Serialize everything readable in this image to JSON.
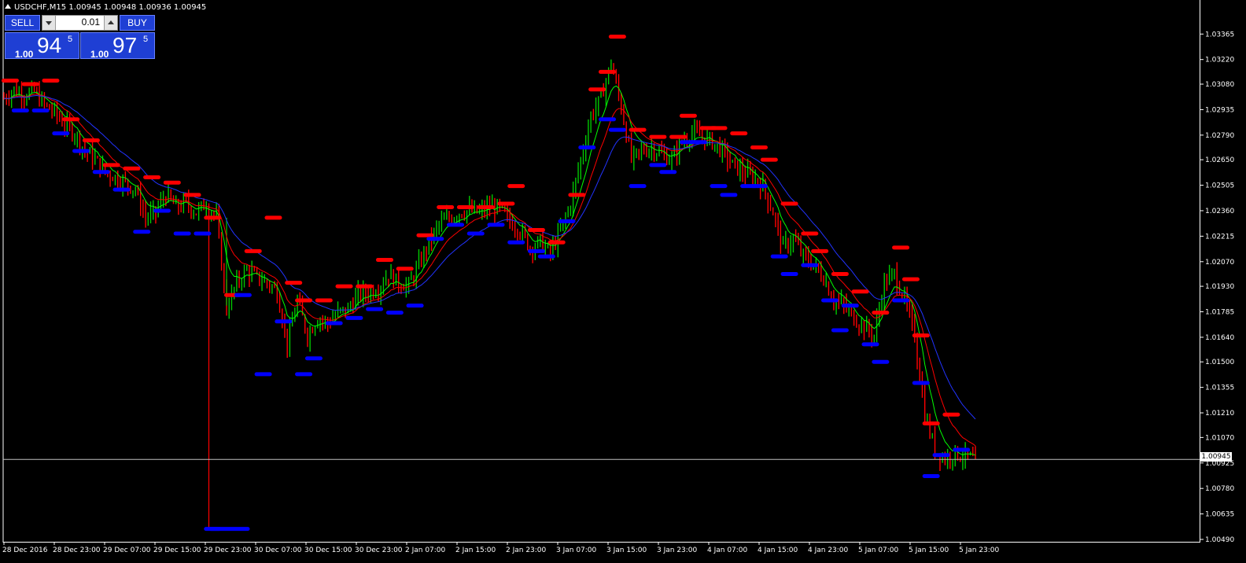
{
  "window": {
    "title": "USDCHF,M15  1.00945 1.00948 1.00936 1.00945"
  },
  "trade_panel": {
    "sell_label": "SELL",
    "buy_label": "BUY",
    "lot_value": "0.01",
    "sell_price": {
      "big": "1.00",
      "main": "94",
      "sup": "5"
    },
    "buy_price": {
      "big": "1.00",
      "main": "97",
      "sup": "5"
    }
  },
  "current_price_label": "1.00945",
  "colors": {
    "background": "#000000",
    "bull_candle": "#00c800",
    "bear_candle": "#ff0000",
    "axis": "#ffffff",
    "panel_blue": "#1f3fd4",
    "ma_fast": "#00ff00",
    "ma_mid": "#ff0000",
    "ma_slow": "#2233ff",
    "fractal_up": "#ff0000",
    "fractal_down": "#0000ff"
  },
  "chart_data": {
    "type": "candlestick",
    "symbol": "USDCHF",
    "timeframe": "M15",
    "ylim": [
      1.0049,
      1.0342
    ],
    "y_ticks": [
      "1.03365",
      "1.03220",
      "1.03080",
      "1.02935",
      "1.02790",
      "1.02650",
      "1.02505",
      "1.02360",
      "1.02215",
      "1.02070",
      "1.01930",
      "1.01785",
      "1.01640",
      "1.01500",
      "1.01355",
      "1.01210",
      "1.01070",
      "1.00925",
      "1.00780",
      "1.00635",
      "1.00490"
    ],
    "x_ticks": [
      "28 Dec 2016",
      "28 Dec 23:00",
      "29 Dec 07:00",
      "29 Dec 15:00",
      "29 Dec 23:00",
      "30 Dec 07:00",
      "30 Dec 15:00",
      "30 Dec 23:00",
      "2 Jan 07:00",
      "2 Jan 15:00",
      "2 Jan 23:00",
      "3 Jan 07:00",
      "3 Jan 15:00",
      "3 Jan 23:00",
      "4 Jan 07:00",
      "4 Jan 15:00",
      "4 Jan 23:00",
      "5 Jan 07:00",
      "5 Jan 15:00",
      "5 Jan 23:00"
    ],
    "current_price": 1.00945,
    "close_path": [
      [
        0,
        1.03
      ],
      [
        2,
        1.0305
      ],
      [
        4,
        1.0302
      ],
      [
        6,
        1.0304
      ],
      [
        8,
        1.0296
      ],
      [
        10,
        1.0292
      ],
      [
        12,
        1.0285
      ],
      [
        14,
        1.028
      ],
      [
        16,
        1.027
      ],
      [
        18,
        1.0265
      ],
      [
        20,
        1.0258
      ],
      [
        22,
        1.0255
      ],
      [
        24,
        1.0252
      ],
      [
        26,
        1.0248
      ],
      [
        28,
        1.0232
      ],
      [
        30,
        1.0235
      ],
      [
        32,
        1.0245
      ],
      [
        34,
        1.0238
      ],
      [
        36,
        1.024
      ],
      [
        38,
        1.0235
      ],
      [
        40,
        1.024
      ],
      [
        42,
        1.0232
      ],
      [
        44,
        1.018
      ],
      [
        46,
        1.0195
      ],
      [
        48,
        1.0202
      ],
      [
        50,
        1.0198
      ],
      [
        52,
        1.0195
      ],
      [
        54,
        1.019
      ],
      [
        56,
        1.016
      ],
      [
        58,
        1.0185
      ],
      [
        60,
        1.0165
      ],
      [
        62,
        1.0175
      ],
      [
        64,
        1.0172
      ],
      [
        66,
        1.0178
      ],
      [
        68,
        1.018
      ],
      [
        70,
        1.0188
      ],
      [
        72,
        1.019
      ],
      [
        74,
        1.0192
      ],
      [
        76,
        1.02
      ],
      [
        78,
        1.0195
      ],
      [
        80,
        1.0193
      ],
      [
        82,
        1.0205
      ],
      [
        84,
        1.0218
      ],
      [
        86,
        1.0228
      ],
      [
        88,
        1.0232
      ],
      [
        90,
        1.0235
      ],
      [
        92,
        1.0236
      ],
      [
        94,
        1.0235
      ],
      [
        96,
        1.0238
      ],
      [
        98,
        1.0237
      ],
      [
        100,
        1.023
      ],
      [
        102,
        1.0225
      ],
      [
        104,
        1.0215
      ],
      [
        106,
        1.0218
      ],
      [
        108,
        1.0212
      ],
      [
        110,
        1.0225
      ],
      [
        112,
        1.024
      ],
      [
        114,
        1.0265
      ],
      [
        116,
        1.029
      ],
      [
        118,
        1.03
      ],
      [
        120,
        1.032
      ],
      [
        122,
        1.0295
      ],
      [
        124,
        1.0265
      ],
      [
        126,
        1.027
      ],
      [
        128,
        1.0272
      ],
      [
        130,
        1.0268
      ],
      [
        132,
        1.0265
      ],
      [
        134,
        1.0275
      ],
      [
        136,
        1.028
      ],
      [
        138,
        1.0278
      ],
      [
        140,
        1.0275
      ],
      [
        142,
        1.027
      ],
      [
        144,
        1.0262
      ],
      [
        146,
        1.0258
      ],
      [
        148,
        1.0255
      ],
      [
        150,
        1.025
      ],
      [
        152,
        1.0235
      ],
      [
        154,
        1.0215
      ],
      [
        156,
        1.022
      ],
      [
        158,
        1.021
      ],
      [
        160,
        1.0205
      ],
      [
        162,
        1.0198
      ],
      [
        164,
        1.0185
      ],
      [
        166,
        1.0182
      ],
      [
        168,
        1.0175
      ],
      [
        170,
        1.017
      ],
      [
        172,
        1.0165
      ],
      [
        174,
        1.0195
      ],
      [
        176,
        1.02
      ],
      [
        178,
        1.0185
      ],
      [
        180,
        1.0165
      ],
      [
        182,
        1.012
      ],
      [
        184,
        1.01
      ],
      [
        186,
        1.0095
      ],
      [
        188,
        1.0098
      ],
      [
        190,
        1.0096
      ],
      [
        192,
        1.00945
      ]
    ],
    "fractals_up": [
      [
        0,
        1.031
      ],
      [
        4,
        1.0308
      ],
      [
        8,
        1.031
      ],
      [
        12,
        1.0288
      ],
      [
        16,
        1.0276
      ],
      [
        20,
        1.0262
      ],
      [
        24,
        1.026
      ],
      [
        28,
        1.0255
      ],
      [
        32,
        1.0252
      ],
      [
        36,
        1.0245
      ],
      [
        40,
        1.0232
      ],
      [
        44,
        1.0188
      ],
      [
        48,
        1.0213
      ],
      [
        52,
        1.0232
      ],
      [
        56,
        1.0195
      ],
      [
        58,
        1.0185
      ],
      [
        62,
        1.0185
      ],
      [
        66,
        1.0193
      ],
      [
        70,
        1.0193
      ],
      [
        74,
        1.0208
      ],
      [
        78,
        1.0203
      ],
      [
        82,
        1.0222
      ],
      [
        86,
        1.0238
      ],
      [
        90,
        1.0238
      ],
      [
        94,
        1.0238
      ],
      [
        98,
        1.024
      ],
      [
        100,
        1.025
      ],
      [
        104,
        1.0225
      ],
      [
        108,
        1.0218
      ],
      [
        112,
        1.0245
      ],
      [
        116,
        1.0305
      ],
      [
        118,
        1.0315
      ],
      [
        120,
        1.0335
      ],
      [
        124,
        1.0282
      ],
      [
        128,
        1.0278
      ],
      [
        132,
        1.0278
      ],
      [
        134,
        1.029
      ],
      [
        138,
        1.0283
      ],
      [
        140,
        1.0283
      ],
      [
        144,
        1.028
      ],
      [
        148,
        1.0272
      ],
      [
        150,
        1.0265
      ],
      [
        154,
        1.024
      ],
      [
        158,
        1.0223
      ],
      [
        160,
        1.0213
      ],
      [
        164,
        1.02
      ],
      [
        168,
        1.019
      ],
      [
        172,
        1.0178
      ],
      [
        176,
        1.0215
      ],
      [
        178,
        1.0197
      ],
      [
        180,
        1.0165
      ],
      [
        182,
        1.0115
      ],
      [
        186,
        1.012
      ]
    ],
    "fractals_down": [
      [
        2,
        1.0293
      ],
      [
        6,
        1.0293
      ],
      [
        10,
        1.028
      ],
      [
        14,
        1.027
      ],
      [
        18,
        1.0258
      ],
      [
        22,
        1.0248
      ],
      [
        26,
        1.0224
      ],
      [
        30,
        1.0236
      ],
      [
        34,
        1.0223
      ],
      [
        38,
        1.0223
      ],
      [
        40,
        1.0055
      ],
      [
        46,
        1.0188
      ],
      [
        50,
        1.0143
      ],
      [
        54,
        1.0173
      ],
      [
        58,
        1.0143
      ],
      [
        60,
        1.0152
      ],
      [
        64,
        1.0172
      ],
      [
        68,
        1.0175
      ],
      [
        72,
        1.018
      ],
      [
        76,
        1.0178
      ],
      [
        80,
        1.0182
      ],
      [
        84,
        1.022
      ],
      [
        88,
        1.0228
      ],
      [
        92,
        1.0223
      ],
      [
        96,
        1.0228
      ],
      [
        100,
        1.0218
      ],
      [
        104,
        1.0213
      ],
      [
        106,
        1.021
      ],
      [
        110,
        1.023
      ],
      [
        114,
        1.0272
      ],
      [
        118,
        1.0288
      ],
      [
        120,
        1.0282
      ],
      [
        124,
        1.025
      ],
      [
        128,
        1.0262
      ],
      [
        130,
        1.0258
      ],
      [
        134,
        1.0275
      ],
      [
        136,
        1.0275
      ],
      [
        140,
        1.025
      ],
      [
        142,
        1.0245
      ],
      [
        146,
        1.025
      ],
      [
        148,
        1.025
      ],
      [
        152,
        1.021
      ],
      [
        154,
        1.02
      ],
      [
        158,
        1.0205
      ],
      [
        162,
        1.0185
      ],
      [
        164,
        1.0168
      ],
      [
        166,
        1.0182
      ],
      [
        170,
        1.016
      ],
      [
        172,
        1.015
      ],
      [
        176,
        1.0185
      ],
      [
        180,
        1.0138
      ],
      [
        182,
        1.0085
      ],
      [
        184,
        1.0097
      ],
      [
        188,
        1.01
      ]
    ]
  }
}
